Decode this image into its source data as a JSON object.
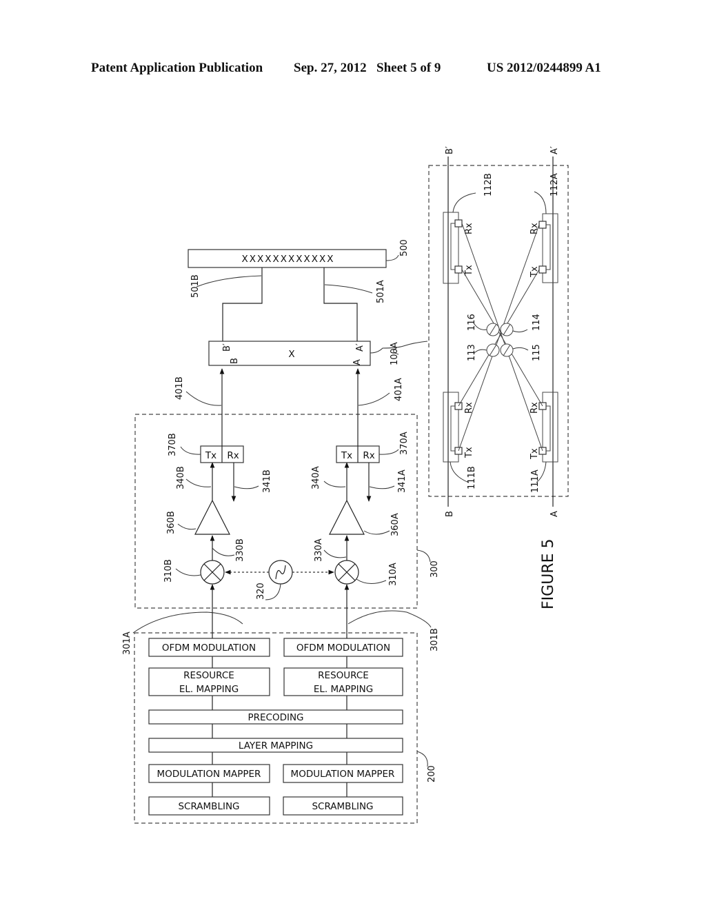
{
  "header": {
    "publication": "Patent Application Publication",
    "date": "Sep. 27, 2012",
    "sheet": "Sheet 5 of 9",
    "number": "US 2012/0244899 A1"
  },
  "figure_label": "FIGURE 5",
  "block_200": {
    "ref": "200",
    "left_column": [
      "OFDM MODULATION",
      "RESOURCE",
      "EL. MAPPING",
      "MODULATION MAPPER",
      "SCRAMBLING"
    ],
    "right_column": [
      "OFDM MODULATION",
      "RESOURCE",
      "EL. MAPPING",
      "MODULATION MAPPER",
      "SCRAMBLING"
    ],
    "shared": {
      "precoding": "PRECODING",
      "layer_mapping": "LAYER MAPPING"
    },
    "outputs": {
      "left": "301A",
      "right": "301B"
    }
  },
  "block_300": {
    "ref": "300",
    "oscillator": "320",
    "mixers": {
      "left": "310B",
      "right": "310A"
    },
    "mixer_outputs": {
      "left": "330B",
      "right": "330A"
    },
    "amplifiers": {
      "left": "360B",
      "right": "360A"
    },
    "amp_outputs": {
      "left": "340B",
      "right": "340A"
    },
    "rx_outputs": {
      "left": "341B",
      "right": "341A"
    },
    "transceivers": {
      "left": "370B",
      "right": "370A"
    },
    "tx_label": "Tx",
    "rx_label": "Rx"
  },
  "links": {
    "left": "401B",
    "right": "401A"
  },
  "block_100A": {
    "ref": "100A",
    "center": "X",
    "ports": {
      "b": "B",
      "b_prime": "B′",
      "a": "A",
      "a_prime": "A′"
    }
  },
  "block_500": {
    "ref": "500",
    "text": "XXXXXXXXXXXX",
    "inputs": {
      "left": "501B",
      "right": "501A"
    }
  },
  "detail_100A": {
    "lines": {
      "b": "B",
      "b_prime": "B′",
      "a": "A",
      "a_prime": "A′"
    },
    "units": {
      "b_bottom": "111B",
      "a_bottom": "111A",
      "b_top": "112B",
      "a_top": "112A"
    },
    "polarizers": [
      "113",
      "114",
      "115",
      "116"
    ],
    "tx_label": "Tx",
    "rx_label": "Rx"
  }
}
